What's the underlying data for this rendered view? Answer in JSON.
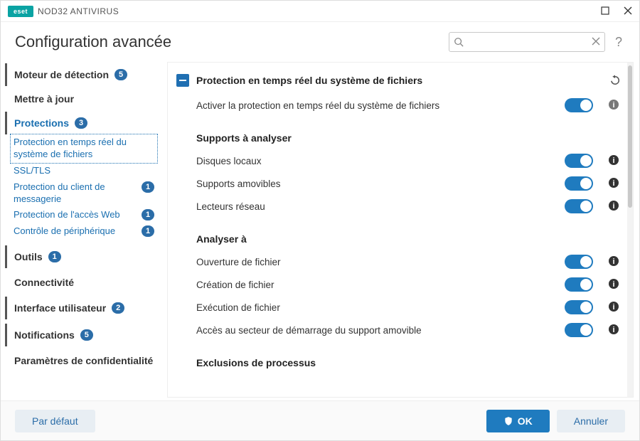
{
  "titlebar": {
    "brand_badge": "eset",
    "brand_text": "NOD32 ANTIVIRUS"
  },
  "header": {
    "title": "Configuration avancée",
    "search_placeholder": "",
    "help_label": "?"
  },
  "sidebar": {
    "items": [
      {
        "label": "Moteur de détection",
        "badge": "5",
        "bar": true
      },
      {
        "label": "Mettre à jour",
        "bar": false
      },
      {
        "label": "Protections",
        "badge": "3",
        "bar": true,
        "blue": true,
        "children": [
          {
            "label": "Protection en temps réel du système de fichiers",
            "selected": true
          },
          {
            "label": "SSL/TLS"
          },
          {
            "label": "Protection du client de messagerie",
            "badge": "1"
          },
          {
            "label": "Protection de l'accès Web",
            "badge": "1"
          },
          {
            "label": "Contrôle de périphérique",
            "badge": "1"
          }
        ]
      },
      {
        "label": "Outils",
        "badge": "1",
        "bar": true
      },
      {
        "label": "Connectivité",
        "bar": false
      },
      {
        "label": "Interface utilisateur",
        "badge": "2",
        "bar": true
      },
      {
        "label": "Notifications",
        "badge": "5",
        "bar": true
      },
      {
        "label": "Paramètres de confidentialité",
        "bar": false
      }
    ]
  },
  "main": {
    "section_title": "Protection en temps réel du système de fichiers",
    "rows_top": [
      {
        "label": "Activer la protection en temps réel du système de fichiers",
        "on": true,
        "info_dim": true
      }
    ],
    "group1_title": "Supports à analyser",
    "group1_rows": [
      {
        "label": "Disques locaux",
        "on": true
      },
      {
        "label": "Supports amovibles",
        "on": true
      },
      {
        "label": "Lecteurs réseau",
        "on": true
      }
    ],
    "group2_title": "Analyser à",
    "group2_rows": [
      {
        "label": "Ouverture de fichier",
        "on": true
      },
      {
        "label": "Création de fichier",
        "on": true
      },
      {
        "label": "Exécution de fichier",
        "on": true
      },
      {
        "label": "Accès au secteur de démarrage du support amovible",
        "on": true
      }
    ],
    "group3_title": "Exclusions de processus"
  },
  "footer": {
    "default_label": "Par défaut",
    "ok_label": "OK",
    "cancel_label": "Annuler"
  }
}
